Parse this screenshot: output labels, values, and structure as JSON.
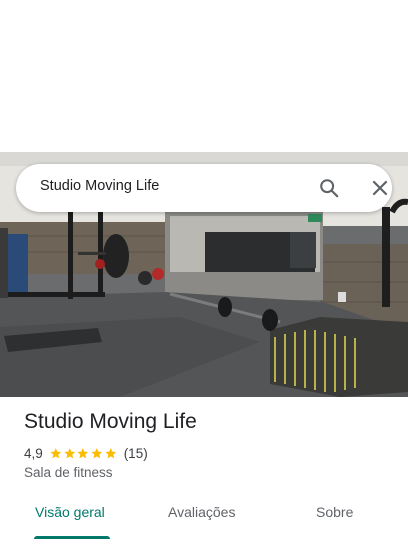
{
  "search": {
    "query": "Studio Moving Life"
  },
  "place": {
    "name": "Studio Moving Life",
    "rating": "4,9",
    "stars": 5,
    "review_count": "(15)",
    "category": "Sala de fitness"
  },
  "tabs": [
    {
      "label": "Visão geral",
      "active": true
    },
    {
      "label": "Avaliações",
      "active": false
    },
    {
      "label": "Sobre",
      "active": false
    }
  ],
  "colors": {
    "accent": "#00796b",
    "star": "#fbbc04"
  },
  "icons": {
    "search": "search-icon",
    "close": "close-icon",
    "star": "star-icon"
  }
}
